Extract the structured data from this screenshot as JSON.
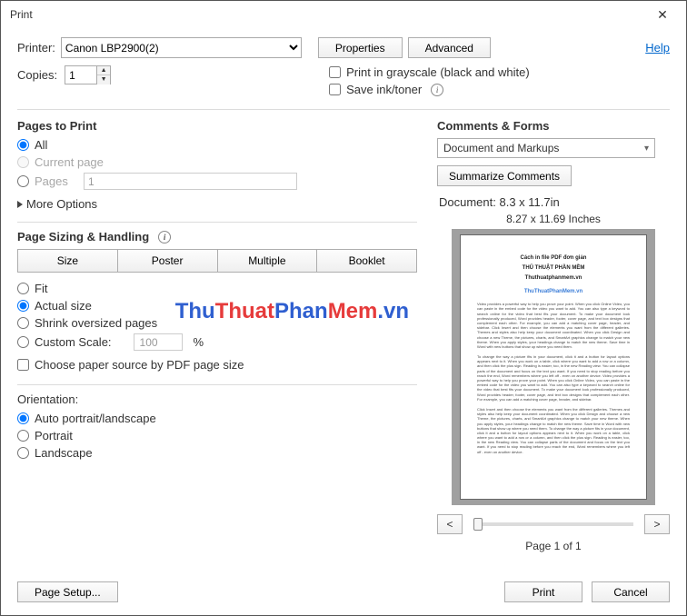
{
  "window": {
    "title": "Print",
    "close": "✕"
  },
  "top": {
    "printer_label": "Printer:",
    "printer_value": "Canon LBP2900(2)",
    "properties": "Properties",
    "advanced": "Advanced",
    "help": "Help",
    "copies_label": "Copies:",
    "copies_value": "1",
    "grayscale": "Print in grayscale (black and white)",
    "save_ink": "Save ink/toner"
  },
  "pages": {
    "title": "Pages to Print",
    "all": "All",
    "current": "Current page",
    "pages_label": "Pages",
    "pages_value": "1",
    "more": "More Options"
  },
  "sizing": {
    "title": "Page Sizing & Handling",
    "size": "Size",
    "poster": "Poster",
    "multiple": "Multiple",
    "booklet": "Booklet",
    "fit": "Fit",
    "actual": "Actual size",
    "shrink": "Shrink oversized pages",
    "custom": "Custom Scale:",
    "scale_value": "100",
    "scale_pct": "%",
    "choose_paper": "Choose paper source by PDF page size"
  },
  "orientation": {
    "title": "Orientation:",
    "auto": "Auto portrait/landscape",
    "portrait": "Portrait",
    "landscape": "Landscape"
  },
  "comments": {
    "title": "Comments & Forms",
    "value": "Document and Markups",
    "summarize": "Summarize Comments",
    "doc_dim": "Document: 8.3 x 11.7in",
    "preview_dim": "8.27 x 11.69 Inches"
  },
  "preview": {
    "t1": "Cách in file PDF đơn giản",
    "t2": "THỦ THUẬT PHẦN MỀM",
    "t3": "Thuthuatphanmem.vn",
    "link": "ThuThuatPhanMem.vn",
    "body1": "Video provides a powerful way to help you prove your point. When you click Online Video, you can paste in the embed code for the video you want to add. You can also type a keyword to search online for the video that best fits your document. To make your document look professionally produced, Word provides header, footer, cover page, and text box designs that complement each other. For example, you can add a matching cover page, header, and sidebar. Click Insert and then choose the elements you want from the different galleries. Themes and styles also help keep your document coordinated. When you click Design and choose a new Theme, the pictures, charts, and SmartArt graphics change to match your new theme. When you apply styles, your headings change to match the new theme. Save time in Word with new buttons that show up where you need them.",
    "body2": "To change the way a picture fits in your document, click it and a button for layout options appears next to it. When you work on a table, click where you want to add a row or a column, and then click the plus sign. Reading is easier, too, in the new Reading view. You can collapse parts of the document and focus on the text you want. If you need to stop reading before you reach the end, Word remembers where you left off - even on another device. Video provides a powerful way to help you prove your point. When you click Online Video, you can paste in the embed code for the video you want to add. You can also type a keyword to search online for the video that best fits your document. To make your document look professionally produced, Word provides header, footer, cover page, and text box designs that complement each other. For example, you can add a matching cover page, header, and sidebar.",
    "body3": "Click Insert and then choose the elements you want from the different galleries. Themes and styles also help keep your document coordinated. When you click Design and choose a new Theme, the pictures, charts, and SmartArt graphics change to match your new theme. When you apply styles, your headings change to match the new theme. Save time in Word with new buttons that show up where you need them. To change the way a picture fits in your document, click it and a button for layout options appears next to it. When you work on a table, click where you want to add a row or a column, and then click the plus sign. Reading is easier, too, in the new Reading view. You can collapse parts of the document and focus on the text you want. If you need to stop reading before you reach the end, Word remembers where you left off - even on another device."
  },
  "nav": {
    "prev": "<",
    "next": ">",
    "page_of": "Page 1 of 1"
  },
  "footer": {
    "page_setup": "Page Setup...",
    "print": "Print",
    "cancel": "Cancel"
  },
  "watermark": {
    "a": "Thu",
    "b": "Thuat",
    "c": "Phan",
    "d": "Mem",
    "e": ".vn"
  }
}
